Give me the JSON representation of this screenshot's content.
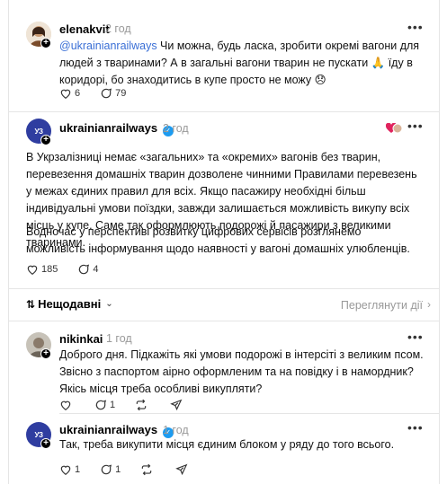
{
  "post1": {
    "username": "elenakvit",
    "time": "2 год",
    "mention": "@ukrainianrailways",
    "text_after_mention": " Чи можна, будь ласка, зробити окремі вагони для людей з тваринами? А в загальні вагони тварин не пускати 🙏 їду в коридорі, бо знаходитись в купе просто не можу 😞",
    "likes": "6",
    "replies": "79"
  },
  "post2": {
    "username": "ukrainianrailways",
    "time": "2 год",
    "avatar_text": "УЗ",
    "paragraph1": "В Укрзалізниці немає «загальних» та «окремих» вагонів без тварин, перевезення домашніх тварин дозволене чинними Правилами перевезень у межах єдиних правил для всіх. Якщо пасажиру необхідні більш індивідуальні умови поїздки, завжди залишається можливість викупу всіх місць у купе. Саме так оформлюють подорожі й пасажири з великими тваринами.",
    "paragraph2": "Водночас у перспективі розвитку цифрових сервісів розглянемо можливість інформування щодо наявності у вагоні домашніх улюбленців.",
    "likes": "185",
    "replies": "4"
  },
  "sort": {
    "label": "Нещодавні",
    "view_activity": "Переглянути дії"
  },
  "reply1": {
    "username": "nikinkai",
    "time": "1 год",
    "text": "Доброго дня. Підкажіть які умови подорожі в інтерсіті з великим псом. Звісно з паспортом аірно оформленим та на повідку і в намордник? Якісь місця треба особливі викупляти?",
    "likes": "",
    "replies": "1"
  },
  "reply2": {
    "username": "ukrainianrailways",
    "time": "1 год",
    "avatar_text": "УЗ",
    "text": "Так, треба викупити місця єдиним блоком у ряду до того всього.",
    "likes": "1",
    "replies": "1"
  },
  "colors": {
    "mention": "#3a6fd6",
    "verified": "#1d9bf0",
    "uz_brand": "#2f3da0"
  }
}
